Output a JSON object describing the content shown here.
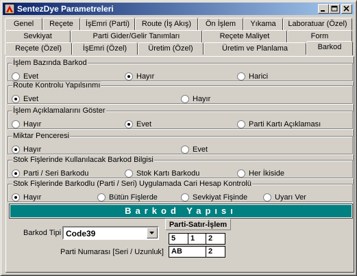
{
  "window": {
    "title": "SentezDye Parametreleri"
  },
  "tabs_row1": [
    "Genel",
    "Reçete",
    "İşEmri (Parti)",
    "Route (İş Akış)",
    "Ön İşlem",
    "Yıkama",
    "Laboratuar (Özel)"
  ],
  "tabs_row2": [
    "Sevkiyat",
    "Parti Gider/Gelir Tanımları",
    "Reçete Maliyet",
    "Form"
  ],
  "tabs_row3": [
    "Reçete (Özel)",
    "İşEmri (Özel)",
    "Üretim (Özel)",
    "Üretim ve Planlama",
    "Barkod"
  ],
  "groups": [
    {
      "title": "İşlem Bazında Barkod",
      "options": [
        "Evet",
        "Hayır",
        "Harici"
      ],
      "selected": "Hayır"
    },
    {
      "title": "Route Kontrolu Yapılsınmı",
      "options": [
        "Evet",
        "Hayır"
      ],
      "selected": "Evet"
    },
    {
      "title": "İşlem Açıklamalarını Göster",
      "options": [
        "Hayır",
        "Evet",
        "Parti Kartı Açıklaması"
      ],
      "selected": "Evet"
    },
    {
      "title": "Miktar Penceresi",
      "options": [
        "Hayır",
        "Evet"
      ],
      "selected": "Hayır"
    },
    {
      "title": "Stok Fişlerinde Kullanılacak Barkod Bilgisi",
      "options": [
        "Parti / Seri Barkodu",
        "Stok Kartı Barkodu",
        "Her İkiside"
      ],
      "selected": "Parti / Seri Barkodu"
    },
    {
      "title": "Stok Fişlerinde Barkodlu (Parti / Seri) Uygulamada Cari Hesap Kontrolü",
      "options": [
        "Hayır",
        "Bütün Fişlerde",
        "Sevkiyat Fişinde",
        "Uyarı Ver"
      ],
      "selected": "Hayır"
    }
  ],
  "barkod": {
    "heading": "Barkod Yapısı",
    "type_label": "Barkod Tipi",
    "type_value": "Code39",
    "parti_label": "Parti Numarası [Seri / Uzunluk]",
    "pattern_label": "Parti-Satır-İşlem",
    "pattern_values": [
      "5",
      "1",
      "2"
    ],
    "parti_values": [
      "AB",
      "2"
    ]
  }
}
